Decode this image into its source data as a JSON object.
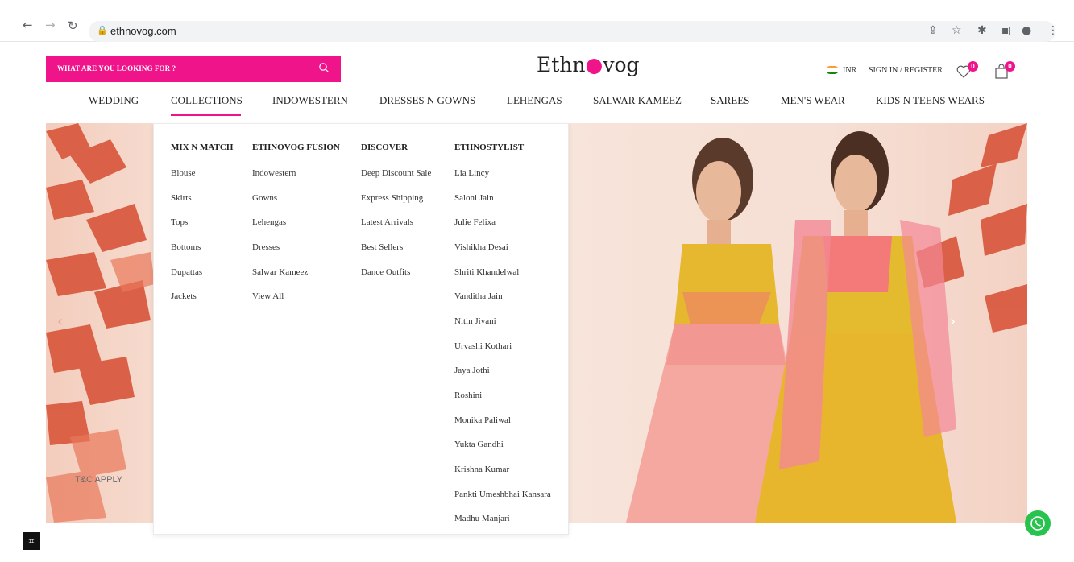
{
  "browser": {
    "url": "ethnovog.com"
  },
  "header": {
    "search_placeholder": "WHAT ARE YOU LOOKING FOR ?",
    "logo_text_1": "Ethn",
    "logo_text_2": "vog",
    "currency": "INR",
    "sign_in": "SIGN IN / REGISTER",
    "wishlist_count": "0",
    "cart_count": "0"
  },
  "nav": {
    "items": [
      "WEDDING",
      "COLLECTIONS",
      "INDOWESTERN",
      "DRESSES N GOWNS",
      "LEHENGAS",
      "SALWAR KAMEEZ",
      "SAREES",
      "MEN'S WEAR",
      "KIDS N TEENS WEARS"
    ],
    "active": "COLLECTIONS"
  },
  "dropdown": {
    "columns": [
      {
        "heading": "MIX N MATCH",
        "links": [
          "Blouse",
          "Skirts",
          "Tops",
          "Bottoms",
          "Dupattas",
          "Jackets"
        ]
      },
      {
        "heading": "ETHNOVOG FUSION",
        "links": [
          "Indowestern",
          "Gowns",
          "Lehengas",
          "Dresses",
          "Salwar Kameez",
          "View All"
        ]
      },
      {
        "heading": "DISCOVER",
        "links": [
          "Deep Discount Sale",
          "Express Shipping",
          "Latest Arrivals",
          "Best Sellers",
          "Dance Outfits"
        ]
      },
      {
        "heading": "ETHNOSTYLIST",
        "links": [
          "Lia Lincy",
          "Saloni Jain",
          "Julie Felixa",
          "Vishikha Desai",
          "Shriti Khandelwal",
          "Vanditha Jain",
          "Nitin Jivani",
          "Urvashi Kothari",
          "Jaya Jothi",
          "Roshini",
          "Monika Paliwal",
          "Yukta Gandhi",
          "Krishna Kumar",
          "Pankti Umeshbhai Kansara",
          "Madhu Manjari"
        ]
      }
    ]
  },
  "hero": {
    "tc": "T&C APPLY"
  },
  "colors": {
    "brand_pink": "#f0148a",
    "whatsapp_green": "#28c24e"
  }
}
